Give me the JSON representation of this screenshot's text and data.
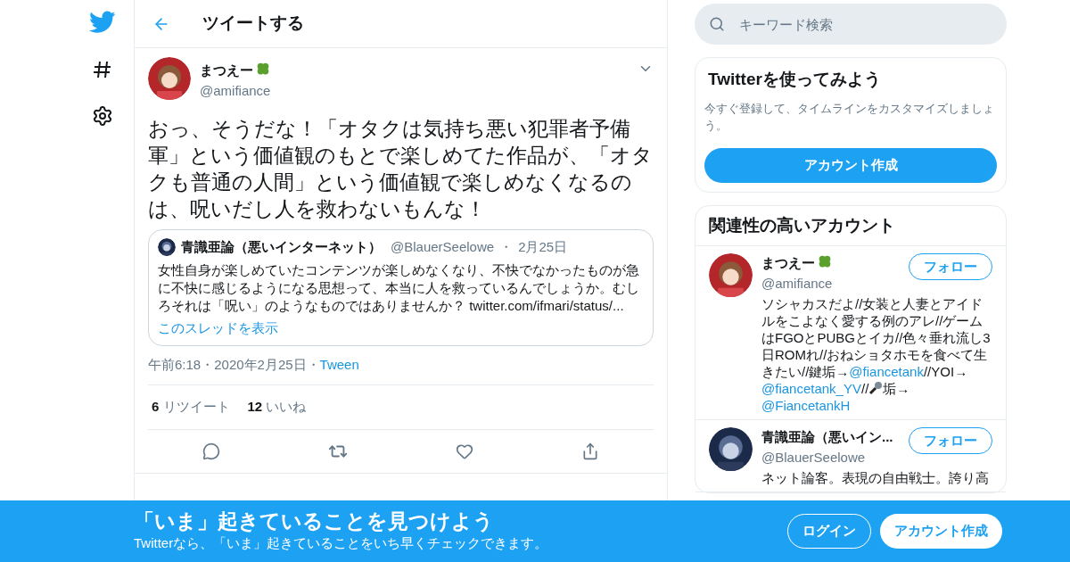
{
  "header": {
    "title": "ツイートする"
  },
  "tweet": {
    "name": "まつえー",
    "handle": "@amifiance",
    "text": "おっ、そうだな！「オタクは気持ち悪い犯罪者予備軍」という価値観のもとで楽しめてた作品が、「オタクも普通の人間」という価値観で楽しめなくなるのは、呪いだし人を救わないもんな！",
    "quote": {
      "name": "青識亜論（悪いインターネット）",
      "handle": "@BlauerSeelowe",
      "separator": "・",
      "date": "2月25日",
      "text": "女性自身が楽しめていたコンテンツが楽しめなくなり、不快でなかったものが急に不快に感じるようになる思想って、本当に人を救っているんでしょうか。むしろそれは「呪い」のようなものではありませんか？",
      "link": "twitter.com/ifmari/status/...",
      "thread": "このスレッドを表示"
    },
    "time": "午前6:18",
    "separator_1": "・",
    "date": "2020年2月25日",
    "separator_2": "・",
    "source": "Tween",
    "stats": [
      {
        "count": "6",
        "label": "リツイート"
      },
      {
        "count": "12",
        "label": "いいね"
      }
    ]
  },
  "search": {
    "placeholder": "キーワード検索"
  },
  "signup": {
    "title": "Twitterを使ってみよう",
    "text": "今すぐ登録して、タイムラインをカスタマイズしましょう。",
    "button": "アカウント作成"
  },
  "related": {
    "title": "関連性の高いアカウント",
    "accounts": [
      {
        "name": "まつえー",
        "handle": "@amifiance",
        "follow": "フォロー",
        "bio": [
          {
            "kind": "text",
            "text": "ソシャカスだよ//女装と人妻とアイドルをこよなく愛する例のアレ//ゲームはFGOとPUBGとイカ//色々垂れ流し3日ROMれ//おねショタホモを食べて生きたい//鍵垢→"
          },
          {
            "kind": "link",
            "text": "@fiancetank"
          },
          {
            "kind": "text",
            "text": "//YOI→ "
          },
          {
            "kind": "link",
            "text": "@fiancetank_YV"
          },
          {
            "kind": "text",
            "text": "//"
          },
          {
            "kind": "mic"
          },
          {
            "kind": "text",
            "text": "垢→ "
          },
          {
            "kind": "link",
            "text": "@FiancetankH"
          }
        ]
      },
      {
        "name": "青識亜論（悪いイン...",
        "handle": "@BlauerSeelowe",
        "follow": "フォロー",
        "bio": [
          {
            "kind": "text",
            "text": "ネット論客。表現の自由戦士。誇り高"
          }
        ]
      }
    ]
  },
  "banner": {
    "title": "「いま」起きていることを見つけよう",
    "text": "Twitterなら、「いま」起きていることをいち早くチェックできます。",
    "login": "ログイン",
    "signup": "アカウント作成"
  }
}
